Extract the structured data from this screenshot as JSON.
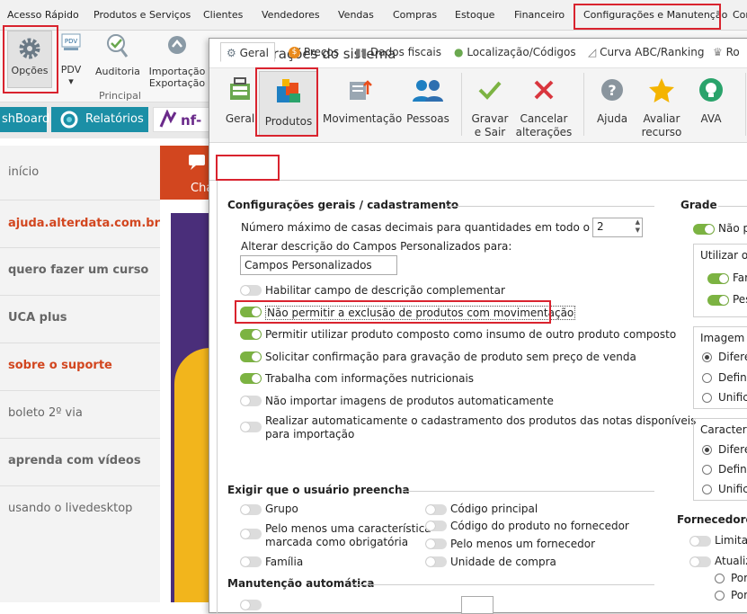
{
  "menu": {
    "items": [
      "Acesso Rápido",
      "Produtos e Serviços",
      "Clientes",
      "Vendedores",
      "Vendas",
      "Compras",
      "Estoque",
      "Financeiro",
      "Configurações e Manutenção",
      "Cor"
    ]
  },
  "ribbon": {
    "opcoes": "Opções",
    "pdv": "PDV",
    "pdv_arrow": "▾",
    "auditoria": "Auditoria",
    "importacao": "Importação",
    "exportacao": "Exportação",
    "group_label": "Principal"
  },
  "quick": {
    "dashboard": "shBoard",
    "relatorios": "Relatórios",
    "nf": "nf-"
  },
  "side": {
    "items": [
      "início",
      "ajuda.alterdata.com.br",
      "quero fazer um curso",
      "UCA plus",
      "sobre o suporte",
      "boleto 2º via",
      "aprenda com vídeos",
      "usando o livedesktop"
    ],
    "cha": "Cha"
  },
  "dialog": {
    "title": "Configurações do sistema",
    "toolbar": {
      "geral": "Geral",
      "produtos": "Produtos",
      "movimentacao": "Movimentação",
      "pessoas": "Pessoas",
      "gravar1": "Gravar",
      "gravar2": "e Sair",
      "cancelar1": "Cancelar",
      "cancelar2": "alterações",
      "ajuda": "Ajuda",
      "avaliar1": "Avaliar",
      "avaliar2": "recurso",
      "ava": "AVA"
    },
    "tabs": [
      "Geral",
      "Preços",
      "Dados fiscais",
      "Localização/Códigos",
      "Curva ABC/Ranking",
      "Ro"
    ],
    "general": {
      "header": "Configurações gerais / cadastramento",
      "decimais_label": "Número máximo de casas decimais para quantidades em todo o sistema",
      "decimais_value": "2",
      "alterar_label": "Alterar descrição do Campos Personalizados para:",
      "campos_value": "Campos Personalizados",
      "toggles": [
        {
          "label": "Habilitar campo de descrição complementar",
          "on": false
        },
        {
          "label": "Não permitir a exclusão de produtos com movimentação",
          "on": true
        },
        {
          "label": "Permitir utilizar produto composto como insumo de outro produto composto",
          "on": true
        },
        {
          "label": "Solicitar confirmação para gravação de produto sem preço de venda",
          "on": true
        },
        {
          "label": "Trabalha com informações nutricionais",
          "on": true
        },
        {
          "label": "Não importar imagens de produtos automaticamente",
          "on": false
        },
        {
          "label": "Realizar automaticamente o cadastramento dos produtos das notas disponíveis",
          "label2": "para importação",
          "on": false
        }
      ]
    },
    "exigir": {
      "header": "Exigir que o usuário preencha",
      "left": [
        "Grupo",
        "Pelo menos uma característica",
        "marcada como obrigatória",
        "Família"
      ],
      "right": [
        "Código principal",
        "Código do produto no fornecedor",
        "Pelo menos um fornecedor",
        "Unidade de compra"
      ]
    },
    "manutencao": {
      "header": "Manutenção automática"
    },
    "grade": {
      "header": "Grade",
      "nao": "Não p",
      "utilizar": "Utilizar o r",
      "far": "Far",
      "pes": "Pes"
    },
    "imagem": {
      "header": "Imagem d",
      "options": [
        "Diferen",
        "Definid",
        "Unifica"
      ]
    },
    "caract": {
      "header": "Característ",
      "options": [
        "Diferen",
        "Definid",
        "Unifica"
      ]
    },
    "fornecedores": {
      "header": "Fornecedores",
      "limitar": "Limitar",
      "atualiz": "Atualiz",
      "por1": "Por",
      "por2": "Por"
    }
  },
  "colors": {
    "accent_red": "#d9232e",
    "toggle_on": "#7cb342",
    "teal": "#1b8fa6",
    "orange": "#d2461f"
  }
}
